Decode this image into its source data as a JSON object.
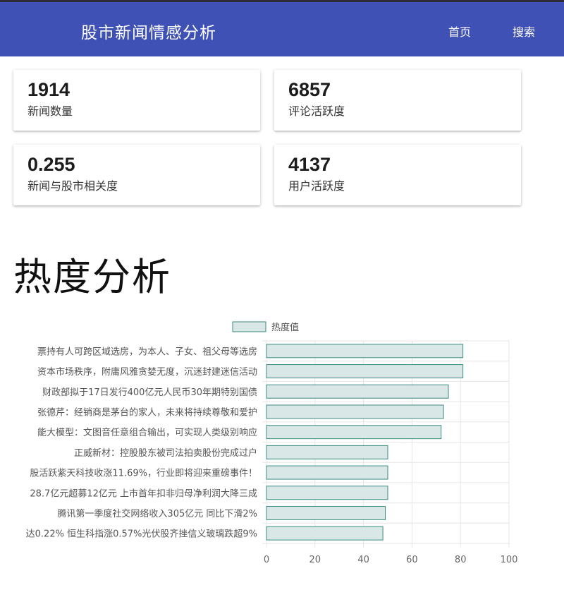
{
  "header": {
    "title": "股市新闻情感分析",
    "nav": [
      {
        "label": "首页"
      },
      {
        "label": "搜索"
      }
    ]
  },
  "stats": [
    {
      "value": "1914",
      "label": "新闻数量"
    },
    {
      "value": "6857",
      "label": "评论活跃度"
    },
    {
      "value": "0.255",
      "label": "新闻与股市相关度"
    },
    {
      "value": "4137",
      "label": "用户活跃度"
    }
  ],
  "section": {
    "title": "热度分析"
  },
  "colors": {
    "header_bg": "#3f51b5",
    "bar_fill": "#d9e7e6",
    "bar_stroke": "#3b8b80"
  },
  "chart_data": {
    "type": "bar",
    "orientation": "horizontal",
    "legend": "top-center",
    "series": [
      {
        "name": "热度值",
        "values": [
          81,
          81,
          75,
          73,
          72,
          50,
          50,
          50,
          49,
          48
        ]
      }
    ],
    "categories": [
      "票持有人可跨区域选房，为本人、子女、祖父母等选房",
      "资本市场秩序，附庸风雅贪婪无度，沉迷封建迷信活动",
      "财政部拟于17日发行400亿元人民币30年期特别国债",
      "张德芹：经销商是茅台的家人，未来将持续尊敬和爱护",
      "能大模型：文图音任意组合输出，可实现人类级别响应",
      "正威新材：控股股东被司法拍卖股份完成过户",
      "股活跃紫天科技收涨11.69%，行业即将迎来重磅事件！",
      "28.7亿元超募12亿元 上市首年扣非归母净利润大降三成",
      "腾讯第一季度社交网络收入305亿元 同比下滑2%",
      "达0.22% 恒生科指涨0.57%光伏股齐挫信义玻璃跌超9%"
    ],
    "xlim": [
      0,
      100
    ],
    "xticks": [
      "0",
      "20",
      "40",
      "60",
      "80",
      "100"
    ],
    "grid": true
  }
}
